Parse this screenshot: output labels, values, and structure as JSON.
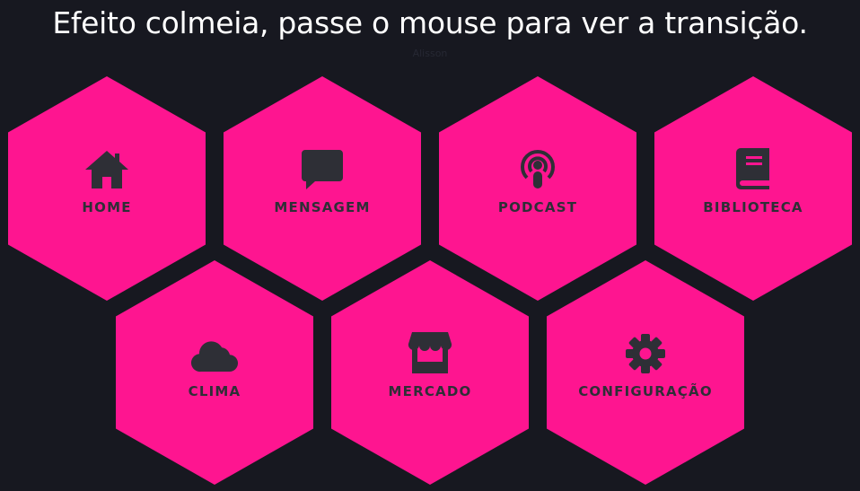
{
  "header": {
    "title": "Efeito colmeia, passe o mouse para ver a transição.",
    "subtitle": "Alisson"
  },
  "colors": {
    "background": "#171820",
    "hex": "#fe1590",
    "icon": "#2e2f36",
    "title": "#ffffff"
  },
  "menu": {
    "items": [
      {
        "label": "HOME",
        "icon": "home-icon"
      },
      {
        "label": "MENSAGEM",
        "icon": "message-icon"
      },
      {
        "label": "PODCAST",
        "icon": "podcast-icon"
      },
      {
        "label": "BIBLIOTECA",
        "icon": "book-icon"
      },
      {
        "label": "CLIMA",
        "icon": "cloud-icon"
      },
      {
        "label": "MERCADO",
        "icon": "store-icon"
      },
      {
        "label": "CONFIGURAÇÃO",
        "icon": "gear-icon"
      }
    ]
  }
}
